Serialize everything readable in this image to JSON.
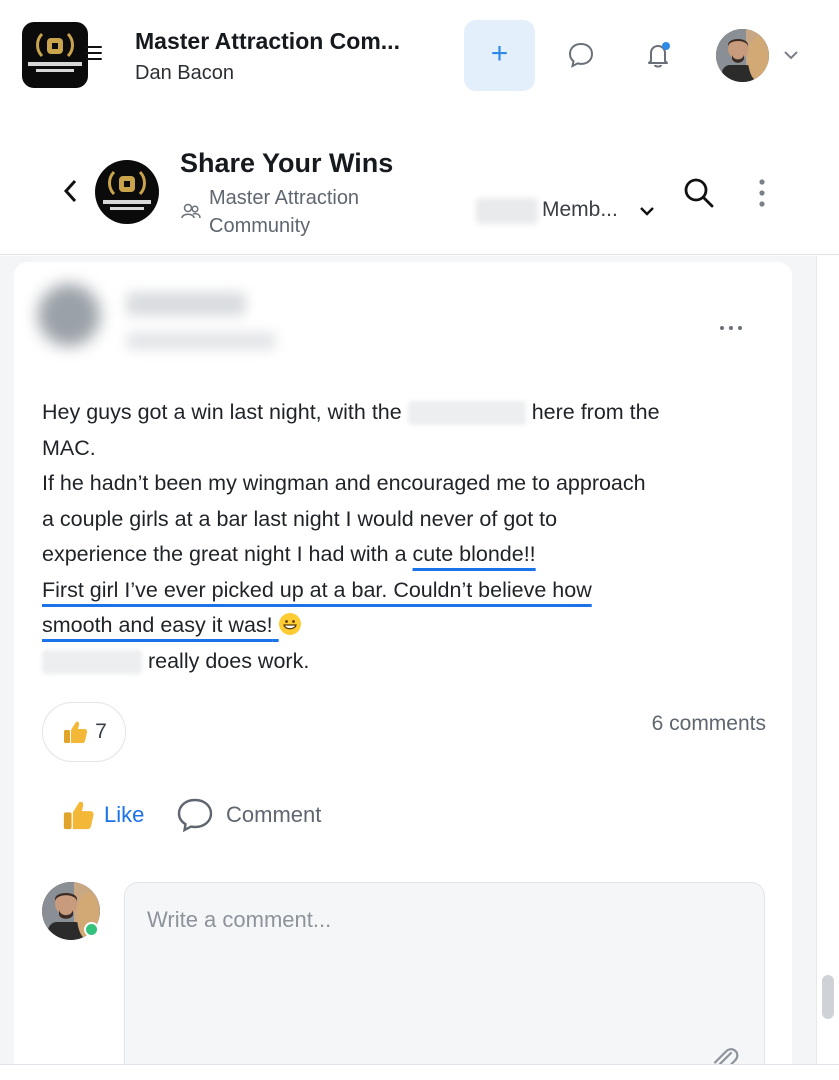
{
  "header": {
    "logo_icon": "master-attraction-community-logo",
    "menu_icon": "hamburger-icon",
    "title": "Master Attraction Com...",
    "subtitle": "Dan Bacon",
    "create_icon": "plus-icon",
    "chat_icon": "chat-bubble-icon",
    "notifications_icon": "bell-icon",
    "notification_dot_color": "#2e8ae6",
    "profile_icon": "user-avatar",
    "profile_menu_icon": "chevron-down-icon"
  },
  "group": {
    "back_icon": "chevron-left-icon",
    "name": "Share Your Wins",
    "community_icon": "community-icon",
    "community_name": "Master Attraction Community",
    "members_label": "Memb...",
    "members_caret_icon": "chevron-down-icon",
    "search_icon": "search-icon",
    "more_icon": "vertical-dots-icon"
  },
  "post": {
    "more_icon": "horizontal-dots-icon",
    "body": {
      "l1_a": "Hey guys got a win last night, with the",
      "l1_b": "here from the",
      "l2": "MAC.",
      "l3": "If he hadn’t been my wingman and encouraged me to approach",
      "l4": "a couple girls at a bar last night I would never of got to",
      "l5_a": "experience the great night I had with a",
      "l5_b": "cute blonde!!",
      "l6": "First girl I’ve ever picked up at a bar. Couldn’t believe how",
      "l7": "smooth and easy it was!",
      "l8": "really does work."
    },
    "reaction_icon": "thumbs-up-icon",
    "reaction_count": "7",
    "comments_count": "6 comments",
    "actions": {
      "like_label": "Like",
      "like_icon": "thumbs-up-icon",
      "comment_label": "Comment",
      "comment_icon": "comment-icon"
    }
  },
  "composer": {
    "avatar_icon": "user-avatar",
    "placeholder": "Write a comment...",
    "attach_icon": "paperclip-icon"
  },
  "colors": {
    "accent": "#1a73e8",
    "create_bg": "#e3f0fc",
    "online": "#34c17b"
  }
}
